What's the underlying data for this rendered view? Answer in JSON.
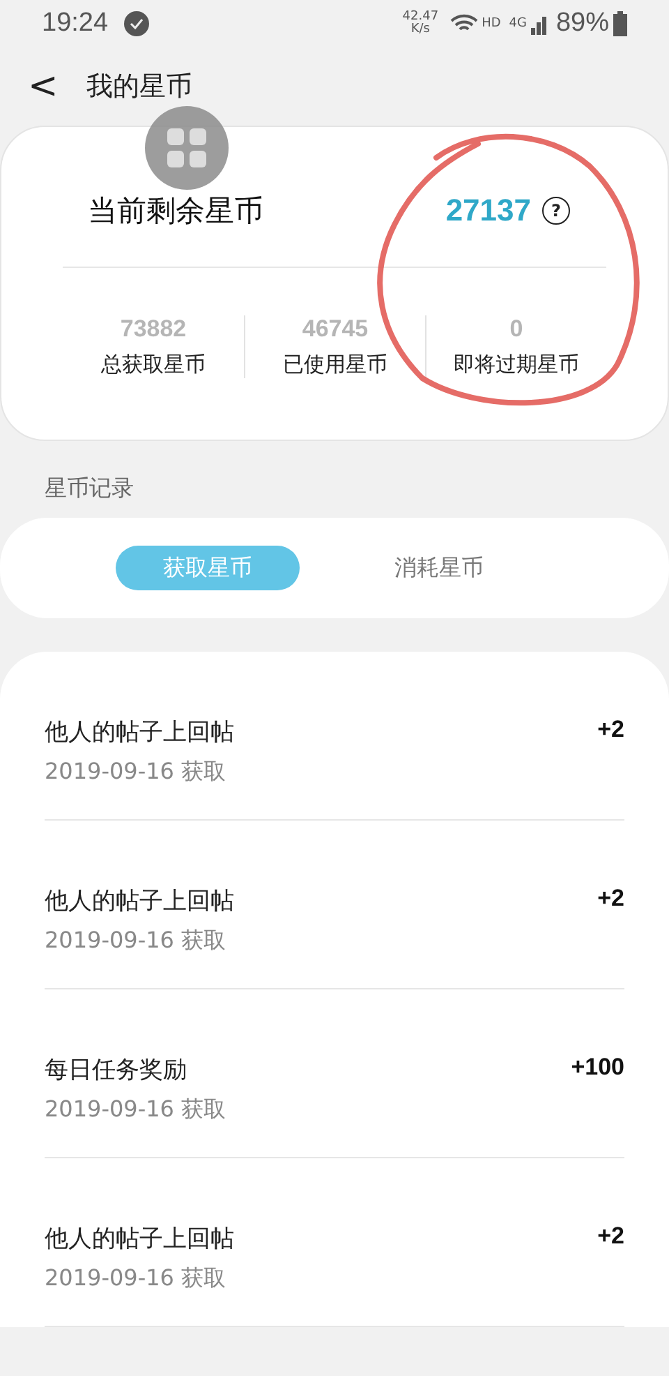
{
  "status_bar": {
    "time": "19:24",
    "net_speed": "42.47",
    "net_unit": "K/s",
    "hd": "HD",
    "network": "4G",
    "battery": "89%"
  },
  "header": {
    "back": "<",
    "title": "我的星币"
  },
  "balance": {
    "label": "当前剩余星币",
    "value": "27137",
    "help": "?"
  },
  "stats": [
    {
      "value": "73882",
      "label": "总获取星币"
    },
    {
      "value": "46745",
      "label": "已使用星币"
    },
    {
      "value": "0",
      "label": "即将过期星币"
    }
  ],
  "section_title": "星币记录",
  "tabs": [
    {
      "label": "获取星币",
      "selected": true
    },
    {
      "label": "消耗星币",
      "selected": false
    }
  ],
  "records": [
    {
      "title": "他人的帖子上回帖",
      "date": "2019-09-16 获取",
      "amount": "+2"
    },
    {
      "title": "他人的帖子上回帖",
      "date": "2019-09-16 获取",
      "amount": "+2"
    },
    {
      "title": "每日任务奖励",
      "date": "2019-09-16 获取",
      "amount": "+100"
    },
    {
      "title": "他人的帖子上回帖",
      "date": "2019-09-16 获取",
      "amount": "+2"
    }
  ]
}
